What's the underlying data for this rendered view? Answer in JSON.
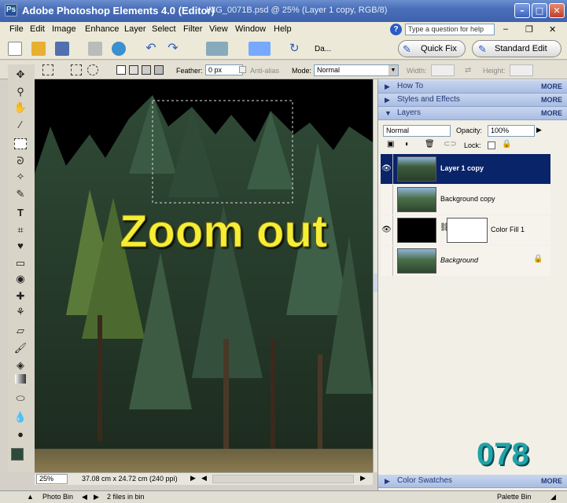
{
  "window": {
    "app_title": "Adobe Photoshop Elements 4.0 (Editor)",
    "doc_title": "IMG_0071B.psd @ 25% (Layer 1 copy, RGB/8)"
  },
  "menu": [
    "File",
    "Edit",
    "Image",
    "Enhance",
    "Layer",
    "Select",
    "Filter",
    "View",
    "Window",
    "Help"
  ],
  "help": {
    "placeholder": "Type a question for help"
  },
  "toolbar": {
    "date_label": "Da...",
    "quick_fix": "Quick Fix",
    "standard_edit": "Standard Edit"
  },
  "options": {
    "feather_label": "Feather:",
    "feather_value": "0 px",
    "antialias": "Anti-alias",
    "mode_label": "Mode:",
    "mode_value": "Normal",
    "width_label": "Width:",
    "height_label": "Height:"
  },
  "overlay": {
    "zoom_text": "Zoom out",
    "counter": "078"
  },
  "panels": {
    "how_to": "How To",
    "styles": "Styles and Effects",
    "layers": "Layers",
    "swatches": "Color Swatches",
    "more": "MORE",
    "blend_mode": "Normal",
    "opacity_label": "Opacity:",
    "opacity_value": "100%",
    "lock_label": "Lock:"
  },
  "layers": [
    {
      "name": "Layer 1 copy",
      "selected": true,
      "visible": true
    },
    {
      "name": "Background copy",
      "selected": false,
      "visible": false
    },
    {
      "name": "Color Fill 1",
      "selected": false,
      "visible": true
    },
    {
      "name": "Background",
      "selected": false,
      "visible": false
    }
  ],
  "status": {
    "zoom": "25%",
    "doc_size": "37.08 cm x 24.72 cm (240 ppi)"
  },
  "bottom": {
    "photo_bin": "Photo Bin",
    "files_info": "2 files in bin",
    "palette_bin": "Palette Bin"
  }
}
